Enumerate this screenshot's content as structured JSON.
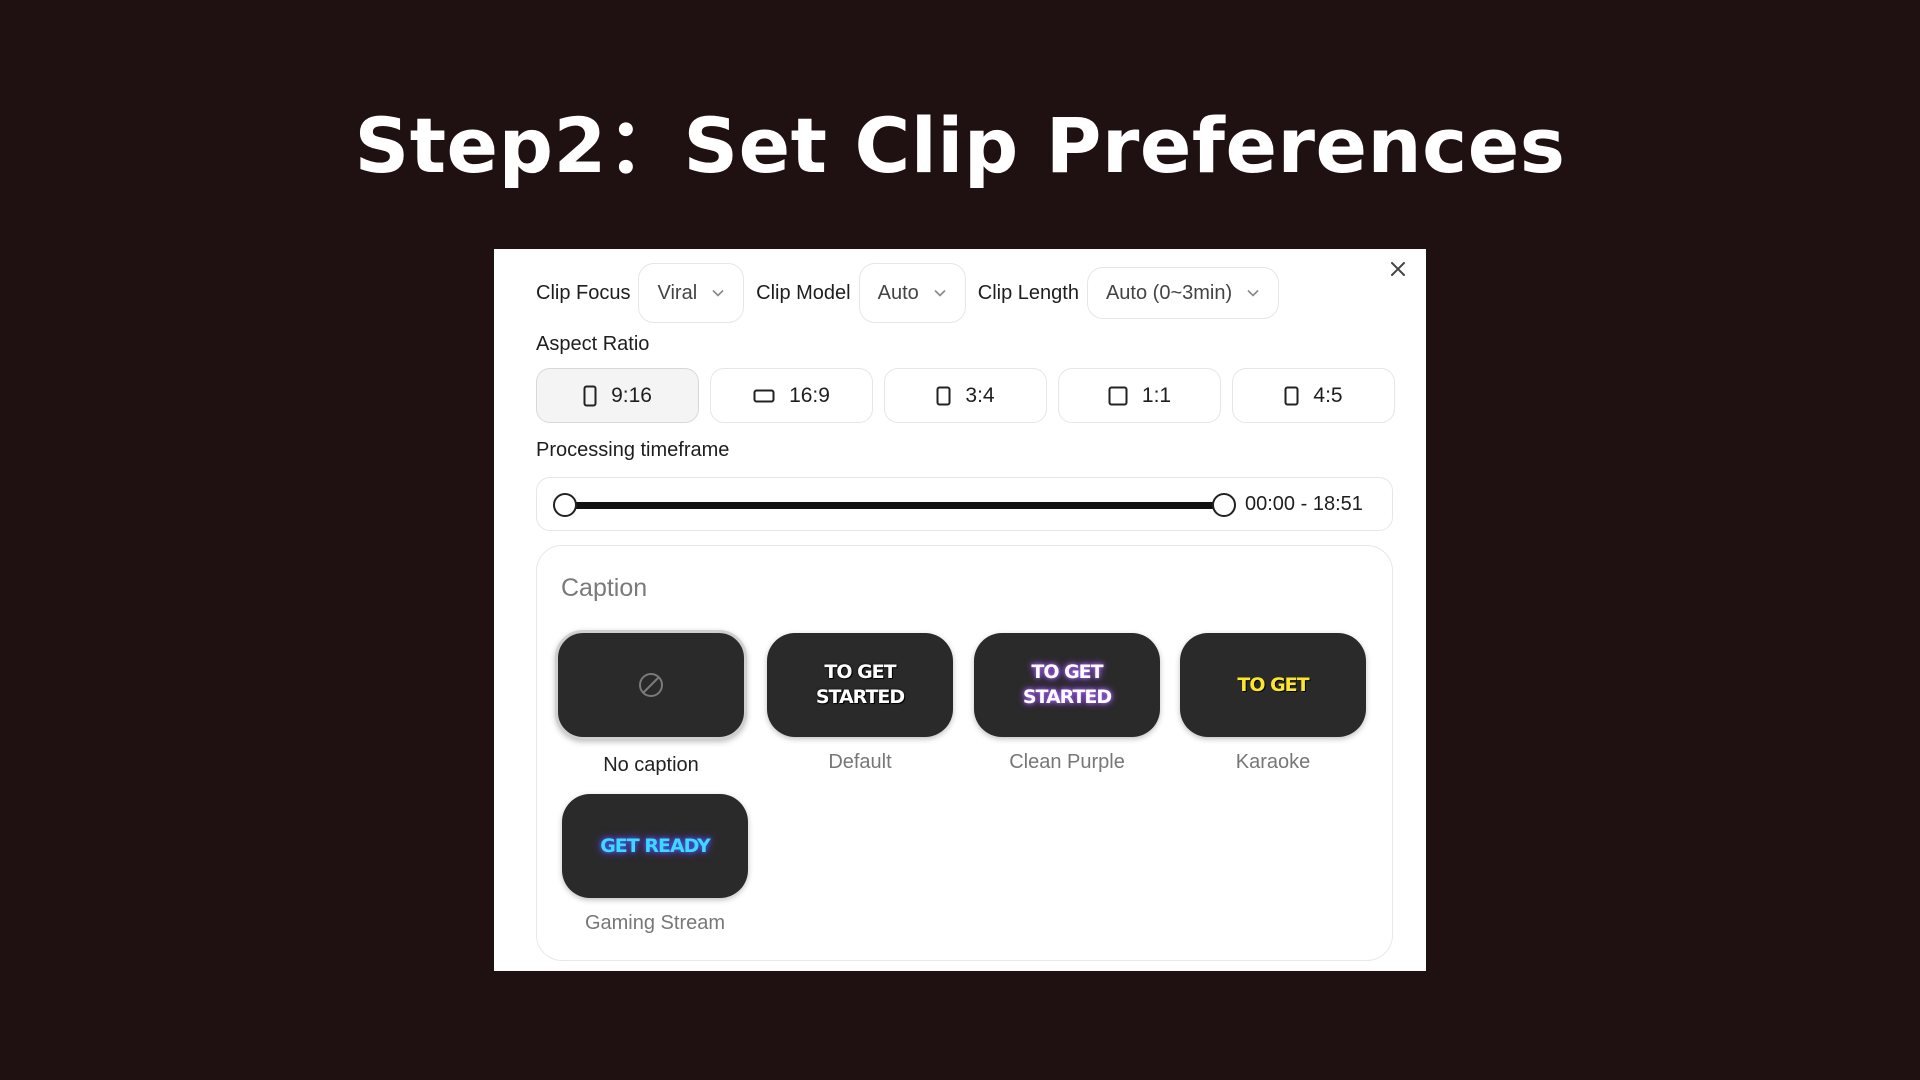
{
  "title": "Step2：Set Clip Preferences",
  "settings": {
    "clip_focus": {
      "label": "Clip Focus",
      "value": "Viral"
    },
    "clip_model": {
      "label": "Clip Model",
      "value": "Auto"
    },
    "clip_length": {
      "label": "Clip Length",
      "value": "Auto (0~3min)"
    }
  },
  "aspect_ratio": {
    "label": "Aspect Ratio",
    "options": [
      {
        "label": "9:16",
        "icon": "portrait-phone-icon",
        "selected": true
      },
      {
        "label": "16:9",
        "icon": "landscape-icon",
        "selected": false
      },
      {
        "label": "3:4",
        "icon": "portrait-icon",
        "selected": false
      },
      {
        "label": "1:1",
        "icon": "square-icon",
        "selected": false
      },
      {
        "label": "4:5",
        "icon": "portrait-icon",
        "selected": false
      }
    ]
  },
  "timeframe": {
    "label": "Processing timeframe",
    "range_text": "00:00 - 18:51",
    "start_fraction": 0.0,
    "end_fraction": 1.0
  },
  "caption": {
    "title": "Caption",
    "presets": [
      {
        "name": "No caption",
        "sample": "",
        "icon": "no-caption-icon",
        "selected": true
      },
      {
        "name": "Default",
        "sample": "TO GET\nSTARTED",
        "selected": false
      },
      {
        "name": "Clean Purple",
        "sample": "TO GET\nSTARTED",
        "selected": false
      },
      {
        "name": "Karaoke",
        "sample": "TO GET",
        "selected": false
      },
      {
        "name": "Gaming Stream",
        "sample": "GET READY",
        "selected": false
      }
    ]
  },
  "colors": {
    "background": "#1f1112",
    "karaoke_text": "#ffe62e",
    "gaming_text": "#3fd8ff",
    "purple_glow": "#9a4dff"
  }
}
